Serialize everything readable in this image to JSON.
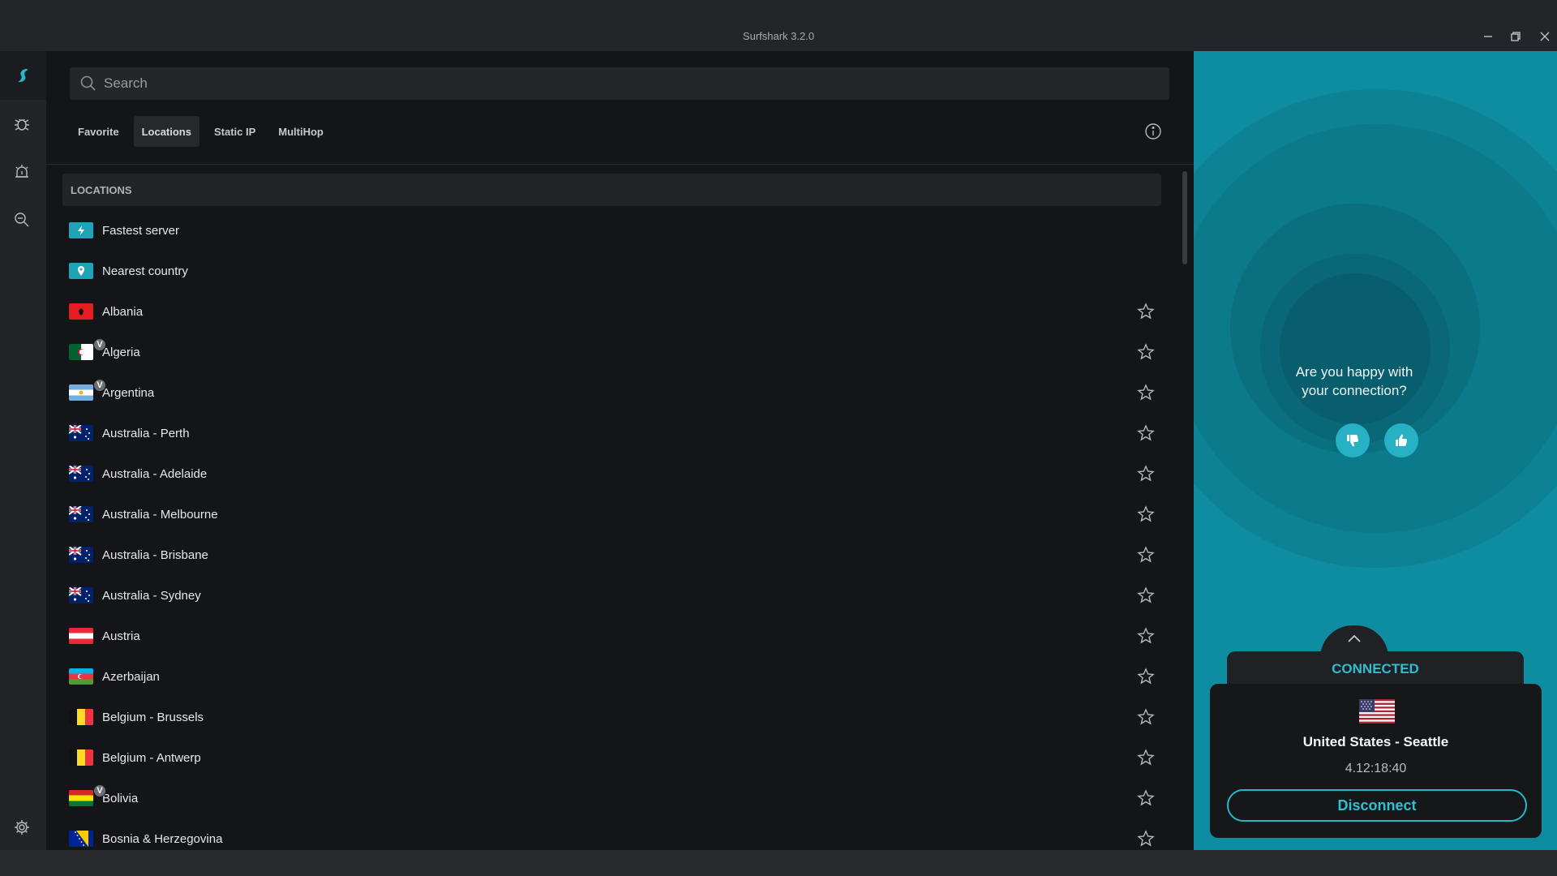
{
  "window": {
    "title": "Surfshark 3.2.0"
  },
  "search": {
    "placeholder": "Search"
  },
  "tabs": [
    {
      "label": "Favorite",
      "active": false
    },
    {
      "label": "Locations",
      "active": true
    },
    {
      "label": "Static IP",
      "active": false
    },
    {
      "label": "MultiHop",
      "active": false
    }
  ],
  "locations": {
    "header": "LOCATIONS",
    "items": [
      {
        "label": "Fastest server",
        "icon": "bolt-icon",
        "starrable": false
      },
      {
        "label": "Nearest country",
        "icon": "pin-icon",
        "starrable": false
      },
      {
        "label": "Albania",
        "icon": "flag-albania",
        "starrable": true
      },
      {
        "label": "Algeria",
        "icon": "flag-algeria",
        "starrable": true,
        "badge": "V"
      },
      {
        "label": "Argentina",
        "icon": "flag-argentina",
        "starrable": true,
        "badge": "V"
      },
      {
        "label": "Australia - Perth",
        "icon": "flag-australia",
        "starrable": true
      },
      {
        "label": "Australia - Adelaide",
        "icon": "flag-australia",
        "starrable": true
      },
      {
        "label": "Australia - Melbourne",
        "icon": "flag-australia",
        "starrable": true
      },
      {
        "label": "Australia - Brisbane",
        "icon": "flag-australia",
        "starrable": true
      },
      {
        "label": "Australia - Sydney",
        "icon": "flag-australia",
        "starrable": true
      },
      {
        "label": "Austria",
        "icon": "flag-austria",
        "starrable": true
      },
      {
        "label": "Azerbaijan",
        "icon": "flag-azerbaijan",
        "starrable": true
      },
      {
        "label": "Belgium - Brussels",
        "icon": "flag-belgium",
        "starrable": true
      },
      {
        "label": "Belgium - Antwerp",
        "icon": "flag-belgium",
        "starrable": true
      },
      {
        "label": "Bolivia",
        "icon": "flag-bolivia",
        "starrable": true,
        "badge": "V"
      },
      {
        "label": "Bosnia & Herzegovina",
        "icon": "flag-bosnia",
        "starrable": true
      }
    ]
  },
  "feedback": {
    "question": "Are you happy with your connection?"
  },
  "connection": {
    "status": "CONNECTED",
    "location": "United States - Seattle",
    "timer": "4.12:18:40",
    "disconnect_label": "Disconnect"
  },
  "colors": {
    "accent": "#0e8da0",
    "accent_bright": "#2ec0d4",
    "background": "#141518"
  }
}
